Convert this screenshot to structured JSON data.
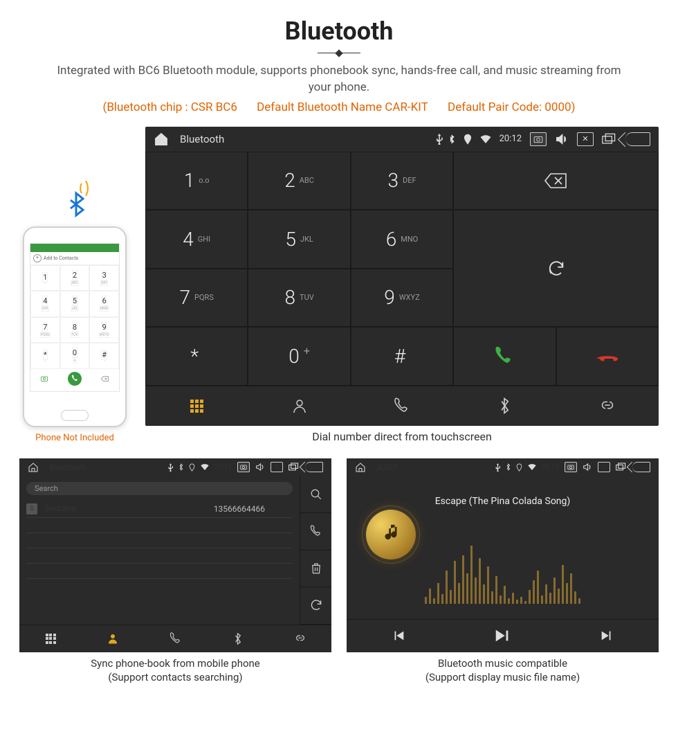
{
  "header": {
    "title": "Bluetooth",
    "description": "Integrated with BC6 Bluetooth module, supports phonebook sync, hands-free call, and music streaming from your phone.",
    "spec_chip": "(Bluetooth chip : CSR BC6",
    "spec_name": "Default Bluetooth Name CAR-KIT",
    "spec_code": "Default Pair Code: 0000)"
  },
  "phone": {
    "add_contacts": "Add to Contacts",
    "keys": [
      {
        "n": "1",
        "l": ""
      },
      {
        "n": "2",
        "l": "ABC"
      },
      {
        "n": "3",
        "l": "DEF"
      },
      {
        "n": "4",
        "l": "GHI"
      },
      {
        "n": "5",
        "l": "JKL"
      },
      {
        "n": "6",
        "l": "MNO"
      },
      {
        "n": "7",
        "l": "PQRS"
      },
      {
        "n": "8",
        "l": "TUV"
      },
      {
        "n": "9",
        "l": "WXYZ"
      },
      {
        "n": "*",
        "l": ""
      },
      {
        "n": "0",
        "l": "+"
      },
      {
        "n": "#",
        "l": ""
      }
    ],
    "note": "Phone Not Included"
  },
  "dialer": {
    "status": {
      "title": "Bluetooth",
      "time": "20:12"
    },
    "keys": [
      {
        "n": "1",
        "l": "ᴏ.ᴏ"
      },
      {
        "n": "2",
        "l": "ABC"
      },
      {
        "n": "3",
        "l": "DEF"
      },
      {
        "n": "4",
        "l": "GHI"
      },
      {
        "n": "5",
        "l": "JKL"
      },
      {
        "n": "6",
        "l": "MNO"
      },
      {
        "n": "7",
        "l": "PQRS"
      },
      {
        "n": "8",
        "l": "TUV"
      },
      {
        "n": "9",
        "l": "WXYZ"
      },
      {
        "n": "*",
        "l": ""
      },
      {
        "n": "0",
        "l": "+"
      },
      {
        "n": "#",
        "l": ""
      }
    ],
    "caption": "Dial number direct from touchscreen"
  },
  "contacts": {
    "status": {
      "title": "Bluetooth",
      "time": "20:11"
    },
    "search_placeholder": "Search",
    "name": "Seicane",
    "number": "13566664466",
    "caption_l1": "Sync phone-book from mobile phone",
    "caption_l2": "(Support contacts searching)"
  },
  "music": {
    "status": {
      "title": "A2DP",
      "time": "20:15"
    },
    "song": "Escape (The Pina Colada Song)",
    "caption_l1": "Bluetooth music compatible",
    "caption_l2": "(Support display music file name)"
  },
  "viz_heights": [
    10,
    22,
    8,
    30,
    14,
    48,
    20,
    62,
    30,
    70,
    44,
    84,
    38,
    66,
    28,
    54,
    18,
    40,
    12,
    26,
    8,
    16,
    6,
    10,
    4,
    20,
    34,
    48,
    12,
    28,
    16,
    38,
    22,
    56,
    30,
    44,
    18,
    8
  ]
}
